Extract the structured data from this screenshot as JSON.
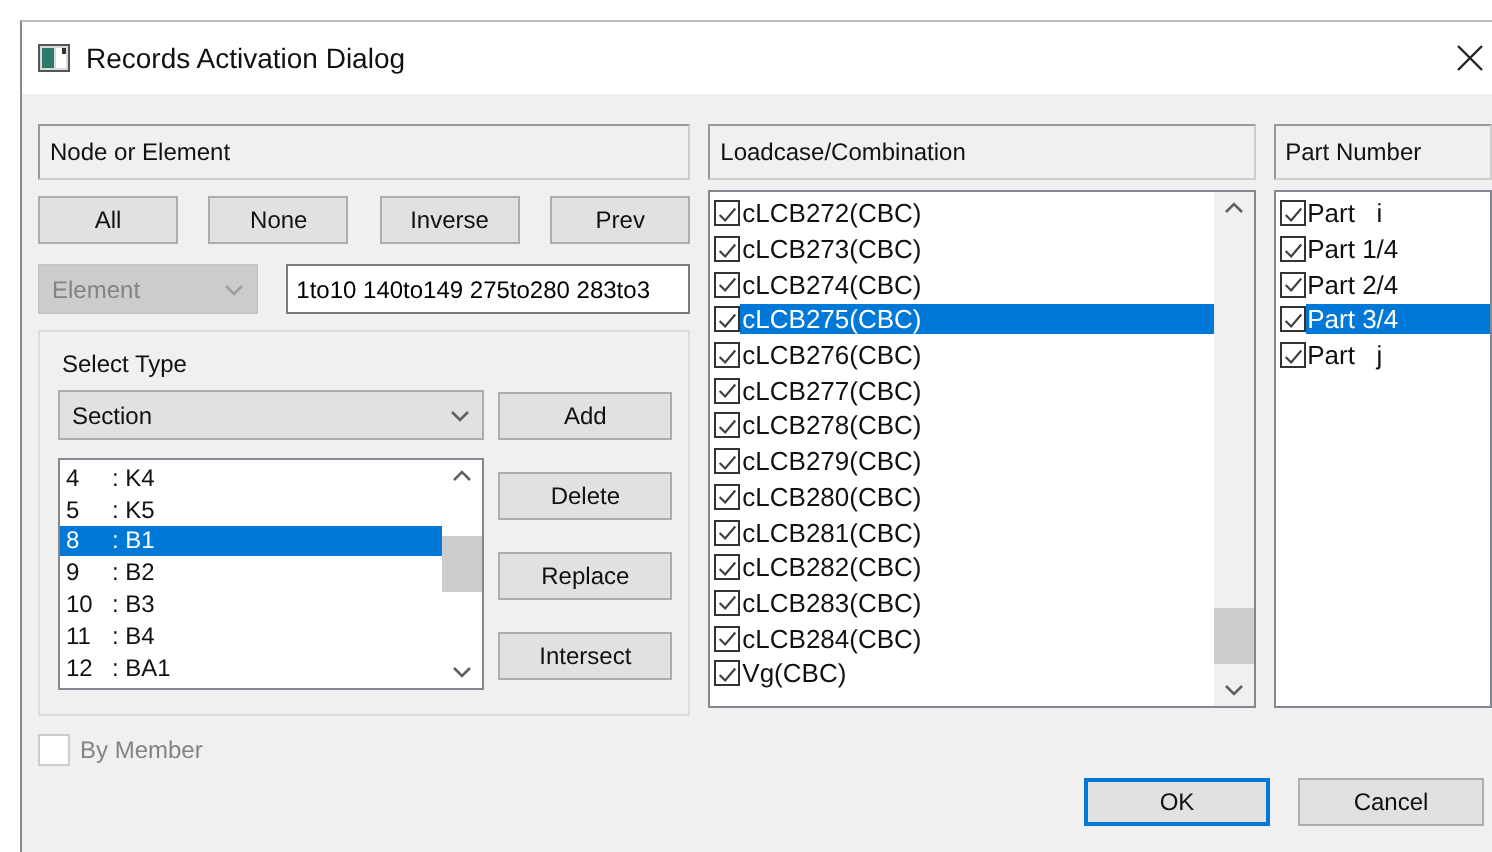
{
  "window": {
    "title": "Records Activation Dialog"
  },
  "node_panel": {
    "header": "Node or Element",
    "buttons": [
      "All",
      "None",
      "Inverse",
      "Prev"
    ],
    "element_dropdown": {
      "value": "Element",
      "disabled": true
    },
    "range_field": {
      "value": "1to10 140to149 275to280 283to3"
    },
    "select_type": {
      "label": "Select Type",
      "dropdown": {
        "value": "Section"
      },
      "items": [
        {
          "number": "4",
          "name": ": K4",
          "selected": false
        },
        {
          "number": "5",
          "name": ": K5",
          "selected": false
        },
        {
          "number": "8",
          "name": ": B1",
          "selected": true
        },
        {
          "number": "9",
          "name": ": B2",
          "selected": false
        },
        {
          "number": "10",
          "name": ": B3",
          "selected": false
        },
        {
          "number": "11",
          "name": ": B4",
          "selected": false
        },
        {
          "number": "12",
          "name": ": BA1",
          "selected": false
        }
      ],
      "buttons": [
        "Add",
        "Delete",
        "Replace",
        "Intersect"
      ]
    },
    "by_member": {
      "label": "By Member",
      "checked": false,
      "disabled": true
    }
  },
  "loadcase_panel": {
    "header": "Loadcase/Combination",
    "items": [
      {
        "label": "cLCB272(CBC)",
        "checked": true,
        "selected": false
      },
      {
        "label": "cLCB273(CBC)",
        "checked": true,
        "selected": false
      },
      {
        "label": "cLCB274(CBC)",
        "checked": true,
        "selected": false
      },
      {
        "label": "cLCB275(CBC)",
        "checked": true,
        "selected": true
      },
      {
        "label": "cLCB276(CBC)",
        "checked": true,
        "selected": false
      },
      {
        "label": "cLCB277(CBC)",
        "checked": true,
        "selected": false
      },
      {
        "label": "cLCB278(CBC)",
        "checked": true,
        "selected": false
      },
      {
        "label": "cLCB279(CBC)",
        "checked": true,
        "selected": false
      },
      {
        "label": "cLCB280(CBC)",
        "checked": true,
        "selected": false
      },
      {
        "label": "cLCB281(CBC)",
        "checked": true,
        "selected": false
      },
      {
        "label": "cLCB282(CBC)",
        "checked": true,
        "selected": false
      },
      {
        "label": "cLCB283(CBC)",
        "checked": true,
        "selected": false
      },
      {
        "label": "cLCB284(CBC)",
        "checked": true,
        "selected": false
      },
      {
        "label": "Vg(CBC)",
        "checked": true,
        "selected": false
      }
    ]
  },
  "part_panel": {
    "header": "Part Number",
    "items": [
      {
        "label": "Part   i",
        "checked": true,
        "selected": false
      },
      {
        "label": "Part 1/4",
        "checked": true,
        "selected": false
      },
      {
        "label": "Part 2/4",
        "checked": true,
        "selected": false
      },
      {
        "label": "Part 3/4",
        "checked": true,
        "selected": true
      },
      {
        "label": "Part   j",
        "checked": true,
        "selected": false
      }
    ]
  },
  "footer_buttons": [
    {
      "label": "OK",
      "default": true
    },
    {
      "label": "Cancel",
      "default": false
    }
  ]
}
